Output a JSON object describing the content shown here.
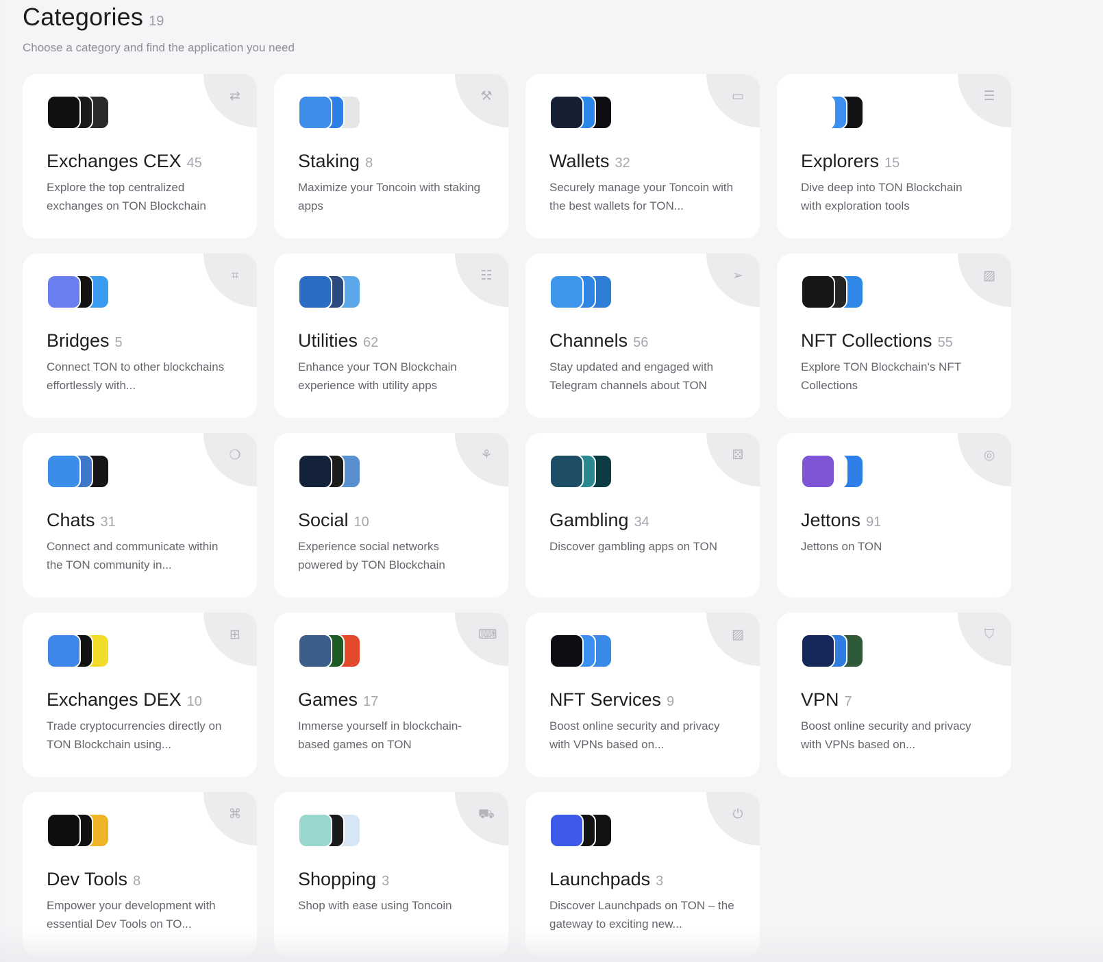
{
  "header": {
    "title": "Categories",
    "count": "19",
    "subtitle": "Choose a category and find the application you need"
  },
  "categories": [
    {
      "name": "Exchanges CEX",
      "count": "45",
      "desc": "Explore the top centralized exchanges on TON Blockchain",
      "icon": "swap-icon",
      "glyph": "⇄",
      "logo_colors": [
        "#111111",
        "#1a1a1a",
        "#2a2a2a"
      ]
    },
    {
      "name": "Staking",
      "count": "8",
      "desc": "Maximize your Toncoin with staking apps",
      "icon": "pickaxe-icon",
      "glyph": "⚒",
      "logo_colors": [
        "#3f8de8",
        "#2d7ee6",
        "#e6e6e6"
      ]
    },
    {
      "name": "Wallets",
      "count": "32",
      "desc": "Securely manage your Toncoin with the best wallets for TON...",
      "icon": "wallet-icon",
      "glyph": "▭",
      "logo_colors": [
        "#152133",
        "#2a86e8",
        "#0e0e12"
      ]
    },
    {
      "name": "Explorers",
      "count": "15",
      "desc": "Dive deep into TON Blockchain with exploration tools",
      "icon": "search-list-icon",
      "glyph": "☰",
      "logo_colors": [
        "#ffffff",
        "#3c8ff0",
        "#121214"
      ]
    },
    {
      "name": "Bridges",
      "count": "5",
      "desc": "Connect TON to other blockchains effortlessly with...",
      "icon": "bridge-icon",
      "glyph": "⌗",
      "logo_colors": [
        "#6a7ef0",
        "#121212",
        "#3a9cf0"
      ]
    },
    {
      "name": "Utilities",
      "count": "62",
      "desc": "Enhance your TON Blockchain experience with utility apps",
      "icon": "checklist-icon",
      "glyph": "☷",
      "logo_colors": [
        "#2b6cc4",
        "#2a4a80",
        "#5aa7ea"
      ]
    },
    {
      "name": "Channels",
      "count": "56",
      "desc": "Stay updated and engaged with Telegram channels about TON",
      "icon": "send-icon",
      "glyph": "➢",
      "logo_colors": [
        "#3e95ec",
        "#2d86e4",
        "#2f7ed8"
      ]
    },
    {
      "name": "NFT Collections",
      "count": "55",
      "desc": "Explore TON Blockchain's NFT Collections",
      "icon": "image-icon",
      "glyph": "▨",
      "logo_colors": [
        "#161618",
        "#242424",
        "#2f88e8"
      ]
    },
    {
      "name": "Chats",
      "count": "31",
      "desc": "Connect and communicate within the TON community in...",
      "icon": "chat-icon",
      "glyph": "❍",
      "logo_colors": [
        "#3a8de8",
        "#3f78c8",
        "#171717"
      ]
    },
    {
      "name": "Social",
      "count": "10",
      "desc": "Experience social networks powered by TON Blockchain",
      "icon": "network-icon",
      "glyph": "⚘",
      "logo_colors": [
        "#14213a",
        "#1c1c1c",
        "#5a8fcf"
      ]
    },
    {
      "name": "Gambling",
      "count": "34",
      "desc": "Discover gambling apps on TON",
      "icon": "dice-icon",
      "glyph": "⚄",
      "logo_colors": [
        "#1e4e66",
        "#2a8890",
        "#0d3b44"
      ]
    },
    {
      "name": "Jettons",
      "count": "91",
      "desc": "Jettons on TON",
      "icon": "coin-icon",
      "glyph": "◎",
      "logo_colors": [
        "#7d55d6",
        "#ffffff",
        "#2f7fe8"
      ]
    },
    {
      "name": "Exchanges DEX",
      "count": "10",
      "desc": "Trade cryptocurrencies directly on TON Blockchain using...",
      "icon": "grid-icon",
      "glyph": "⊞",
      "logo_colors": [
        "#3e86e8",
        "#121212",
        "#f1dc2a"
      ]
    },
    {
      "name": "Games",
      "count": "17",
      "desc": "Immerse yourself in blockchain-based games on TON",
      "icon": "gamepad-icon",
      "glyph": "⌨",
      "logo_colors": [
        "#3a5d8a",
        "#1d5a24",
        "#e34a2c"
      ]
    },
    {
      "name": "NFT Services",
      "count": "9",
      "desc": "Boost online security and privacy with VPNs based on...",
      "icon": "image-icon",
      "glyph": "▨",
      "logo_colors": [
        "#0d0d14",
        "#3b8ff0",
        "#3a8ae8"
      ]
    },
    {
      "name": "VPN",
      "count": "7",
      "desc": "Boost online security and privacy with VPNs based on...",
      "icon": "shield-icon",
      "glyph": "⛉",
      "logo_colors": [
        "#16285a",
        "#2f7de0",
        "#2e5a3a"
      ]
    },
    {
      "name": "Dev Tools",
      "count": "8",
      "desc": "Empower your development with essential Dev Tools on TO...",
      "icon": "code-icon",
      "glyph": "⌘",
      "logo_colors": [
        "#0f0f0f",
        "#111111",
        "#f0b429"
      ]
    },
    {
      "name": "Shopping",
      "count": "3",
      "desc": "Shop with ease using Toncoin",
      "icon": "cart-icon",
      "glyph": "⛟",
      "logo_colors": [
        "#9ad8cf",
        "#1a1a1a",
        "#d7e6f5"
      ]
    },
    {
      "name": "Launchpads",
      "count": "3",
      "desc": "Discover Launchpads on TON – the gateway to exciting new...",
      "icon": "power-icon",
      "glyph": "⏻",
      "logo_colors": [
        "#3d5ae8",
        "#121212",
        "#121212"
      ]
    }
  ]
}
